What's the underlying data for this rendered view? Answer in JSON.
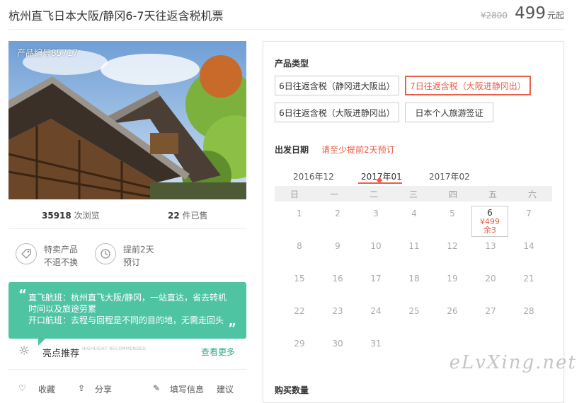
{
  "header": {
    "title": "杭州直飞日本大阪/静冈6-7天往返含税机票",
    "original_price": "¥2800",
    "price": "499",
    "price_unit": "元起"
  },
  "left": {
    "product_code": "产品编号85717",
    "views_count": "35918",
    "views_label": "次浏览",
    "sold_count": "22",
    "sold_label": "件已售",
    "features": [
      {
        "icon": "tag-icon",
        "line1": "特卖产品",
        "line2": "不退不换"
      },
      {
        "icon": "clock-icon",
        "line1": "提前2天",
        "line2": "预订"
      }
    ],
    "highlight_box": {
      "line1": "直飞航班：杭州直飞大阪/静冈，一站直达，省去转机时间以及旅途劳累",
      "line2": "开口航班：去程与回程是不同的目的地，无需走回头"
    },
    "highlight_label": "亮点推荐",
    "highlight_sub": "HIGHLIGHT RECOMMENDED",
    "see_more": "查看更多",
    "actions": [
      "收藏",
      "分享",
      "填写信息",
      "建议"
    ]
  },
  "right": {
    "product_type_title": "产品类型",
    "options": [
      "6日往返含税（静冈进大阪出）",
      "7日往返含税（大阪进静冈出）",
      "6日往返含税（大阪进静冈出）",
      "日本个人旅游签证"
    ],
    "selected_option": 1,
    "departure_title": "出发日期",
    "departure_note": "请至少提前2天预订",
    "months": [
      "2016年12",
      "2017年01",
      "2017年02"
    ],
    "active_month": 1,
    "weekdays": [
      "日",
      "一",
      "二",
      "三",
      "四",
      "五",
      "六"
    ],
    "days": [
      "1",
      "2",
      "3",
      "4",
      "5",
      "7",
      "8",
      "9",
      "10",
      "11",
      "12",
      "13",
      "14",
      "15",
      "16",
      "17",
      "18",
      "19",
      "20",
      "21",
      "22",
      "23",
      "24",
      "25",
      "26",
      "27",
      "28",
      "29",
      "30",
      "31"
    ],
    "selected_day": {
      "day": "6",
      "price": "¥499",
      "remaining": "余3"
    },
    "purchase_title": "购买数量"
  },
  "watermark": "eLvXing.net",
  "colors": {
    "accent": "#e8604a",
    "green": "#4fc4a3",
    "link": "#2aaa7f"
  }
}
